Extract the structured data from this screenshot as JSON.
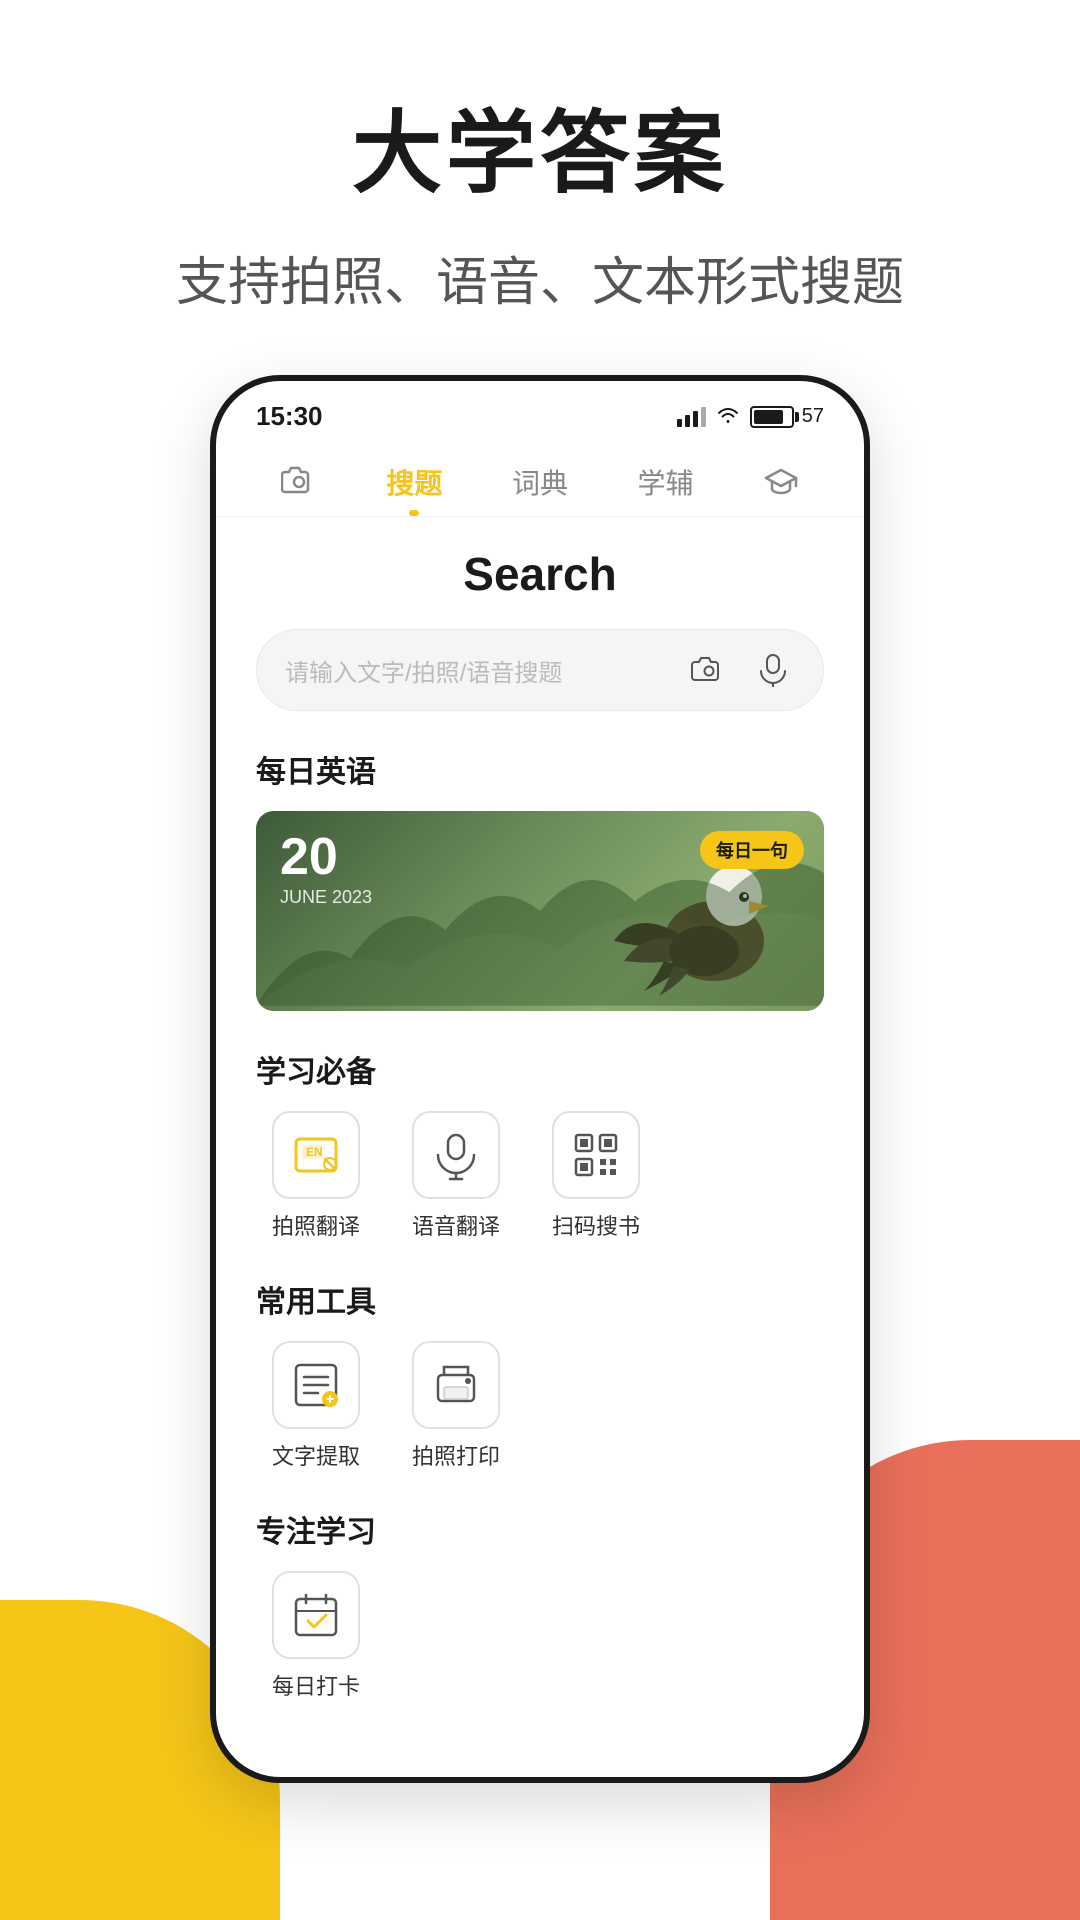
{
  "header": {
    "title": "大学答案",
    "subtitle": "支持拍照、语音、文本形式搜题"
  },
  "phone": {
    "status_bar": {
      "time": "15:30",
      "battery_level": "57"
    },
    "nav_tabs": [
      {
        "id": "camera",
        "label": "",
        "icon": "⊙",
        "is_icon_only": true,
        "active": false
      },
      {
        "id": "search",
        "label": "搜题",
        "active": true
      },
      {
        "id": "dict",
        "label": "词典",
        "active": false
      },
      {
        "id": "tutor",
        "label": "学辅",
        "active": false
      },
      {
        "id": "grad",
        "label": "",
        "icon": "🎓",
        "is_icon_only": true,
        "active": false
      }
    ],
    "search_page": {
      "title": "Search",
      "search_placeholder": "请输入文字/拍照/语音搜题",
      "daily_english": {
        "section_title": "每日英语",
        "date_number": "20",
        "date_sub": "JUNE  2023",
        "badge": "每日一句"
      },
      "study_essentials": {
        "section_title": "学习必备",
        "tools": [
          {
            "id": "photo-translate",
            "label": "拍照翻译",
            "icon": "EN"
          },
          {
            "id": "voice-translate",
            "label": "语音翻译",
            "icon": "mic"
          },
          {
            "id": "scan-search",
            "label": "扫码搜书",
            "icon": "qr"
          }
        ]
      },
      "common_tools": {
        "section_title": "常用工具",
        "tools": [
          {
            "id": "text-extract",
            "label": "文字提取",
            "icon": "extract"
          },
          {
            "id": "photo-print",
            "label": "拍照打印",
            "icon": "print"
          }
        ]
      },
      "focus_study": {
        "section_title": "专注学习",
        "tools": [
          {
            "id": "daily-checkin",
            "label": "每日打卡",
            "icon": "checkin"
          }
        ]
      }
    }
  },
  "colors": {
    "accent": "#F5C518",
    "coral": "#E8705A",
    "active_tab": "#F5C518",
    "text_primary": "#1a1a1a",
    "text_secondary": "#888888"
  }
}
